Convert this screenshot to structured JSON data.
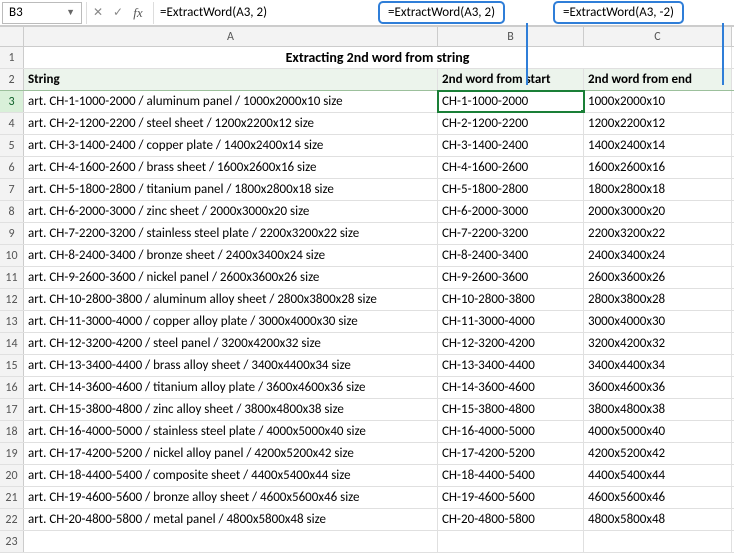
{
  "name_box": "B3",
  "formula_bar": "=ExtractWord(A3, 2)",
  "callouts": {
    "left": "=ExtractWord(A3, 2)",
    "right": "=ExtractWord(A3, -2)"
  },
  "title": "Extracting 2nd word from string",
  "headers": {
    "a": "String",
    "b": "2nd word from start",
    "c": "2nd word from end"
  },
  "cols": [
    "A",
    "B",
    "C"
  ],
  "rows": [
    {
      "n": 3,
      "a": "art. CH-1-1000-2000 / aluminum panel / 1000x2000x10 size",
      "b": "CH-1-1000-2000",
      "c": "1000x2000x10"
    },
    {
      "n": 4,
      "a": "art. CH-2-1200-2200 / steel sheet / 1200x2200x12 size",
      "b": "CH-2-1200-2200",
      "c": "1200x2200x12"
    },
    {
      "n": 5,
      "a": "art. CH-3-1400-2400 / copper plate / 1400x2400x14 size",
      "b": "CH-3-1400-2400",
      "c": "1400x2400x14"
    },
    {
      "n": 6,
      "a": "art. CH-4-1600-2600 / brass sheet / 1600x2600x16 size",
      "b": "CH-4-1600-2600",
      "c": "1600x2600x16"
    },
    {
      "n": 7,
      "a": "art. CH-5-1800-2800 / titanium panel / 1800x2800x18 size",
      "b": "CH-5-1800-2800",
      "c": "1800x2800x18"
    },
    {
      "n": 8,
      "a": "art. CH-6-2000-3000 / zinc sheet / 2000x3000x20 size",
      "b": "CH-6-2000-3000",
      "c": "2000x3000x20"
    },
    {
      "n": 9,
      "a": "art. CH-7-2200-3200 / stainless steel plate / 2200x3200x22 size",
      "b": "CH-7-2200-3200",
      "c": "2200x3200x22"
    },
    {
      "n": 10,
      "a": "art. CH-8-2400-3400 / bronze sheet / 2400x3400x24 size",
      "b": "CH-8-2400-3400",
      "c": "2400x3400x24"
    },
    {
      "n": 11,
      "a": "art. CH-9-2600-3600 / nickel panel / 2600x3600x26 size",
      "b": "CH-9-2600-3600",
      "c": "2600x3600x26"
    },
    {
      "n": 12,
      "a": "art. CH-10-2800-3800 / aluminum alloy sheet / 2800x3800x28 size",
      "b": "CH-10-2800-3800",
      "c": "2800x3800x28"
    },
    {
      "n": 13,
      "a": "art. CH-11-3000-4000 / copper alloy plate / 3000x4000x30 size",
      "b": "CH-11-3000-4000",
      "c": "3000x4000x30"
    },
    {
      "n": 14,
      "a": "art. CH-12-3200-4200 / steel panel / 3200x4200x32 size",
      "b": "CH-12-3200-4200",
      "c": "3200x4200x32"
    },
    {
      "n": 15,
      "a": "art. CH-13-3400-4400 / brass alloy sheet / 3400x4400x34 size",
      "b": "CH-13-3400-4400",
      "c": "3400x4400x34"
    },
    {
      "n": 16,
      "a": "art. CH-14-3600-4600 / titanium alloy plate / 3600x4600x36 size",
      "b": "CH-14-3600-4600",
      "c": "3600x4600x36"
    },
    {
      "n": 17,
      "a": "art. CH-15-3800-4800 / zinc alloy sheet / 3800x4800x38 size",
      "b": "CH-15-3800-4800",
      "c": "3800x4800x38"
    },
    {
      "n": 18,
      "a": "art. CH-16-4000-5000 / stainless steel plate / 4000x5000x40 size",
      "b": "CH-16-4000-5000",
      "c": "4000x5000x40"
    },
    {
      "n": 19,
      "a": "art. CH-17-4200-5200 / nickel alloy panel / 4200x5200x42 size",
      "b": "CH-17-4200-5200",
      "c": "4200x5200x42"
    },
    {
      "n": 20,
      "a": "art. CH-18-4400-5400 / composite sheet / 4400x5400x44 size",
      "b": "CH-18-4400-5400",
      "c": "4400x5400x44"
    },
    {
      "n": 21,
      "a": "art. CH-19-4600-5600 / bronze alloy sheet / 4600x5600x46 size",
      "b": "CH-19-4600-5600",
      "c": "4600x5600x46"
    },
    {
      "n": 22,
      "a": "art. CH-20-4800-5800 / metal panel / 4800x5800x48 size",
      "b": "CH-20-4800-5800",
      "c": "4800x5800x48"
    }
  ],
  "empty_row": 23
}
